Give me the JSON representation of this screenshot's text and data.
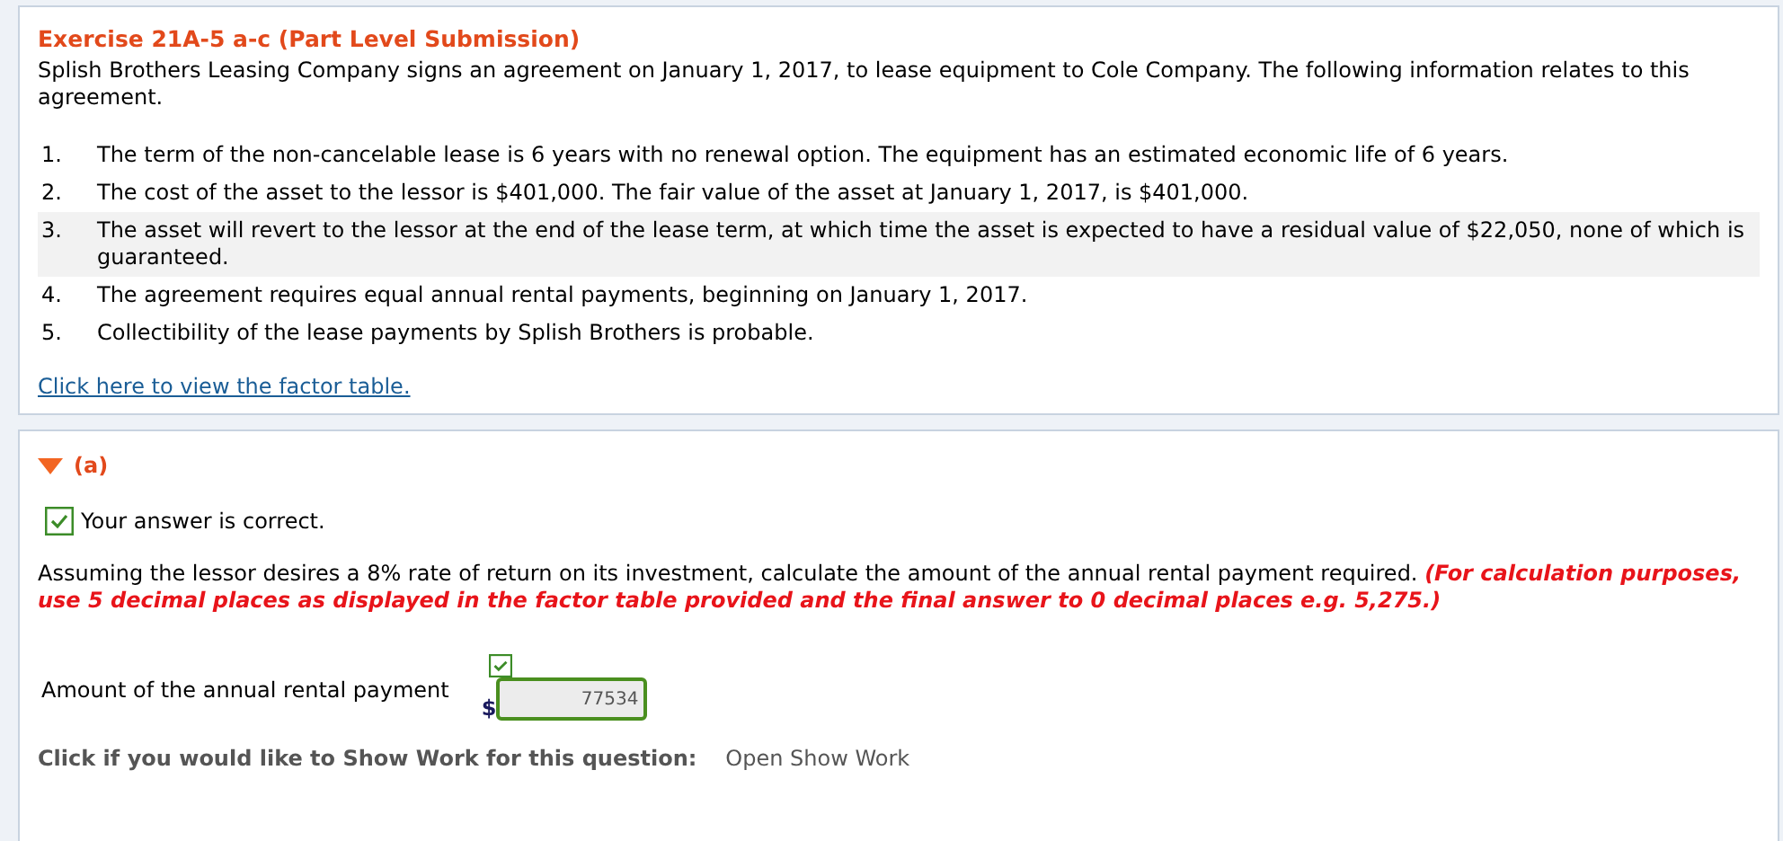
{
  "exercise": {
    "title": "Exercise 21A-5 a-c (Part Level Submission)",
    "intro": "Splish Brothers Leasing Company signs an agreement on January 1, 2017, to lease equipment to Cole Company. The following information relates to this agreement.",
    "facts": [
      {
        "number": "1.",
        "text": "The term of the non-cancelable lease is 6 years with no renewal option. The equipment has an estimated economic life of 6 years.",
        "highlighted": false
      },
      {
        "number": "2.",
        "text": "The cost of the asset to the lessor is $401,000. The fair value of the asset at January 1, 2017, is $401,000.",
        "highlighted": false
      },
      {
        "number": "3.",
        "text": "The asset will revert to the lessor at the end of the lease term, at which time the asset is expected to have a residual value of $22,050, none of which is guaranteed.",
        "highlighted": true
      },
      {
        "number": "4.",
        "text": "The agreement requires equal annual rental payments, beginning on January 1, 2017.",
        "highlighted": false
      },
      {
        "number": "5.",
        "text": "Collectibility of the lease payments by Splish Brothers is probable.",
        "highlighted": false
      }
    ],
    "factor_link": "Click here to view the factor table."
  },
  "part": {
    "label": "(a)",
    "expanded": true,
    "status": {
      "correct": true,
      "text": "Your answer is correct."
    },
    "question": "Assuming the lessor desires a 8% rate of return on its investment, calculate the amount of the annual rental payment required.",
    "note": "(For calculation purposes, use 5 decimal places as displayed in the factor table provided and the final answer to 0 decimal places e.g. 5,275.)",
    "answer": {
      "label": "Amount of the annual rental payment",
      "currency": "$",
      "value": "77534",
      "correct": true
    },
    "show_work": {
      "label": "Click if you would like to Show Work for this question:",
      "link": "Open Show Work"
    }
  }
}
